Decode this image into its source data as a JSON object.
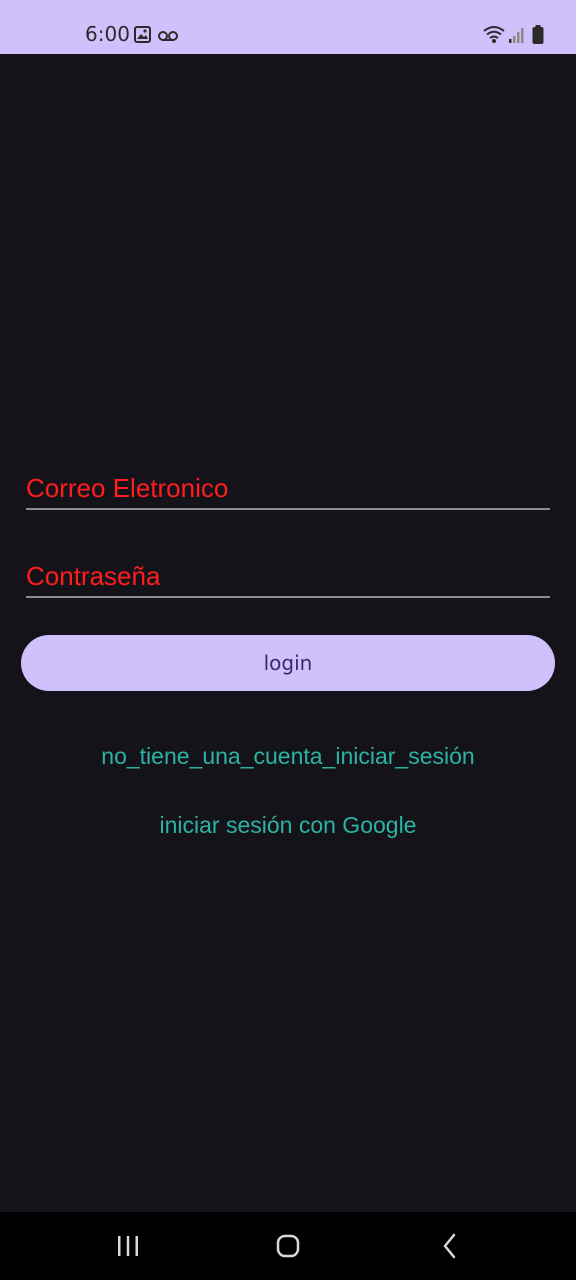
{
  "status_bar": {
    "time": "6:00",
    "icons": [
      "gallery-icon",
      "voicemail-icon",
      "wifi-icon",
      "signal-icon",
      "battery-icon"
    ]
  },
  "form": {
    "email_placeholder": "Correo Eletronico",
    "password_placeholder": "Contraseña",
    "login_label": "login"
  },
  "links": {
    "signup": "no_tiene_una_cuenta_iniciar_sesión",
    "google": "iniciar sesión con Google"
  },
  "nav_bar": {
    "buttons": [
      "recent-apps-icon",
      "home-icon",
      "back-icon"
    ]
  },
  "colors": {
    "accent": "#d0c1fd",
    "background": "#15131a",
    "placeholder": "#ff1d1d",
    "link": "#2bb3a3"
  }
}
